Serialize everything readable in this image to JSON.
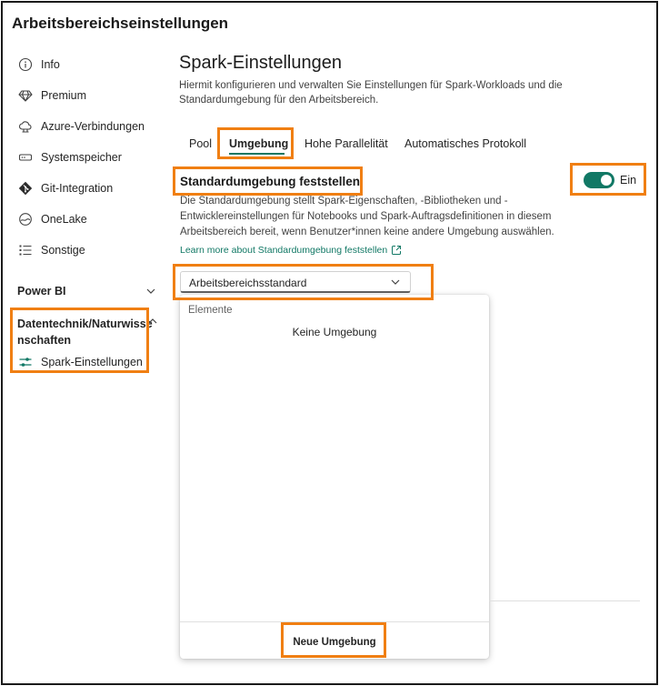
{
  "window": {
    "title": "Arbeitsbereichseinstellungen"
  },
  "sidebar": {
    "items": [
      {
        "label": "Info",
        "icon": "info-icon"
      },
      {
        "label": "Premium",
        "icon": "diamond-icon"
      },
      {
        "label": "Azure-Verbindungen",
        "icon": "cloud-link-icon"
      },
      {
        "label": "Systemspeicher",
        "icon": "storage-icon"
      },
      {
        "label": "Git-Integration",
        "icon": "git-icon"
      },
      {
        "label": "OneLake",
        "icon": "onelake-icon"
      },
      {
        "label": "Sonstige",
        "icon": "list-icon"
      }
    ],
    "sections": [
      {
        "label": "Power BI",
        "expanded": false
      },
      {
        "label": "Datentechnik/Naturwissenschaften",
        "line1": "Datentechnik/Naturwisse",
        "line2": "nschaften",
        "expanded": true,
        "children": [
          {
            "label": "Spark-Einstellungen",
            "icon": "sliders-icon"
          }
        ]
      }
    ]
  },
  "main": {
    "title": "Spark-Einstellungen",
    "description": "Hiermit konfigurieren und verwalten Sie Einstellungen für Spark-Workloads und die Standardumgebung für den Arbeitsbereich.",
    "tabs": [
      {
        "label": "Pool",
        "active": false
      },
      {
        "label": "Umgebung",
        "active": true
      },
      {
        "label": "Hohe Parallelität",
        "active": false
      },
      {
        "label": "Automatisches Protokoll",
        "active": false
      }
    ],
    "env_section": {
      "label": "Standardumgebung feststellen",
      "toggle_state": "Ein",
      "toggle_on": true,
      "description": "Die Standardumgebung stellt Spark-Eigenschaften, -Bibliotheken und -Entwicklereinstellungen für Notebooks und Spark-Auftragsdefinitionen in diesem Arbeitsbereich bereit, wenn Benutzer*innen keine andere Umgebung auswählen.",
      "learn_more": "Learn more about Standardumgebung feststellen"
    },
    "dropdown": {
      "selected": "Arbeitsbereichsstandard",
      "list_header": "Elemente",
      "options": [
        "Keine Umgebung"
      ],
      "new_button": "Neue Umgebung"
    }
  },
  "colors": {
    "accent": "#117865",
    "highlight": "#f07f13"
  }
}
